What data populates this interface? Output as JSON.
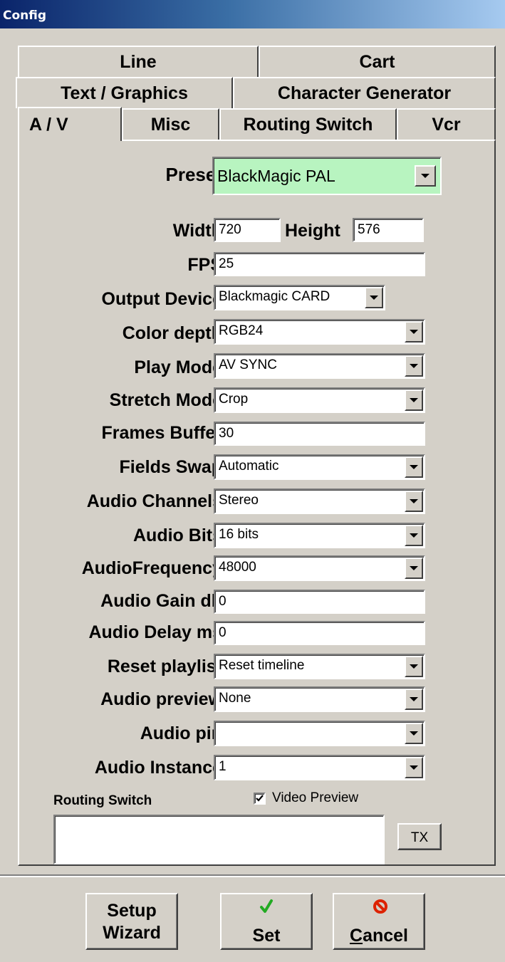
{
  "window": {
    "title": "Config"
  },
  "tabs": {
    "row1": [
      "Line",
      "Cart"
    ],
    "row2": [
      "Text / Graphics",
      "Character Generator"
    ],
    "row3": [
      "A / V",
      "Misc",
      "Routing Switch",
      "Vcr"
    ],
    "active": "A / V"
  },
  "form": {
    "preset": {
      "label": "Preset",
      "value": "BlackMagic PAL",
      "highlight": "#b8f4c0"
    },
    "width": {
      "label": "Width",
      "value": "720"
    },
    "height": {
      "label": "Height",
      "value": "576"
    },
    "fps": {
      "label": "FPS",
      "value": "25"
    },
    "output_device": {
      "label": "Output Device",
      "value": "Blackmagic CARD"
    },
    "color_depth": {
      "label": "Color depth",
      "value": "RGB24"
    },
    "play_mode": {
      "label": "Play Mode",
      "value": "AV SYNC"
    },
    "stretch_mode": {
      "label": "Stretch Mode",
      "value": "Crop"
    },
    "frames_buffer": {
      "label": "Frames Buffer",
      "value": "30"
    },
    "fields_swap": {
      "label": "Fields Swap",
      "value": "Automatic"
    },
    "audio_channels": {
      "label": "Audio Channels",
      "value": "Stereo"
    },
    "audio_bits": {
      "label": "Audio Bits",
      "value": "16 bits"
    },
    "audio_frequency": {
      "label": "AudioFrequency",
      "value": "48000"
    },
    "audio_gain": {
      "label": "Audio Gain db",
      "value": "0"
    },
    "audio_delay": {
      "label": "Audio Delay ms",
      "value": "0"
    },
    "reset_playlist": {
      "label": "Reset playlist",
      "value": "Reset timeline"
    },
    "audio_preview": {
      "label": "Audio preview",
      "value": "None"
    },
    "audio_pin": {
      "label": "Audio pin",
      "value": ""
    },
    "audio_instance": {
      "label": "Audio Instance",
      "value": "1"
    }
  },
  "routing": {
    "label": "Routing Switch",
    "video_preview_label": "Video Preview",
    "video_preview_checked": true,
    "text_value": "",
    "tx_label": "TX"
  },
  "buttons": {
    "setup_line1": "Setup",
    "setup_line2": "Wizard",
    "set": "Set",
    "cancel": "Cancel",
    "check_color": "#22aa22",
    "cancel_icon_color": "#dd2200"
  }
}
